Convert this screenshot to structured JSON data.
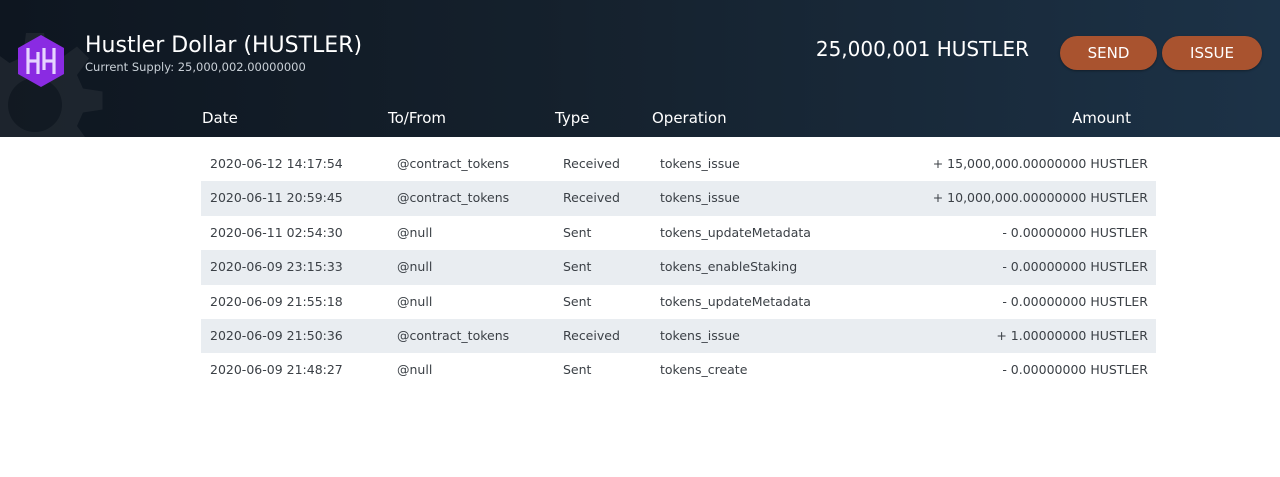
{
  "header": {
    "title": "Hustler Dollar (HUSTLER)",
    "supply": "Current Supply: 25,000,002.00000000",
    "balance": "25,000,001 HUSTLER",
    "send_label": "SEND",
    "issue_label": "ISSUE",
    "logo_icon": "hustler-logo-icon",
    "accent_color": "#a9532f",
    "logo_color": "#8a2be2"
  },
  "table": {
    "columns": [
      "Date",
      "To/From",
      "Type",
      "Operation",
      "Amount"
    ],
    "rows": [
      {
        "date": "2020-06-12 14:17:54",
        "to": "@contract_tokens",
        "type": "Received",
        "op": "tokens_issue",
        "amount": "+ 15,000,000.00000000 HUSTLER"
      },
      {
        "date": "2020-06-11 20:59:45",
        "to": "@contract_tokens",
        "type": "Received",
        "op": "tokens_issue",
        "amount": "+ 10,000,000.00000000 HUSTLER"
      },
      {
        "date": "2020-06-11 02:54:30",
        "to": "@null",
        "type": "Sent",
        "op": "tokens_updateMetadata",
        "amount": "- 0.00000000 HUSTLER"
      },
      {
        "date": "2020-06-09 23:15:33",
        "to": "@null",
        "type": "Sent",
        "op": "tokens_enableStaking",
        "amount": "- 0.00000000 HUSTLER"
      },
      {
        "date": "2020-06-09 21:55:18",
        "to": "@null",
        "type": "Sent",
        "op": "tokens_updateMetadata",
        "amount": "- 0.00000000 HUSTLER"
      },
      {
        "date": "2020-06-09 21:50:36",
        "to": "@contract_tokens",
        "type": "Received",
        "op": "tokens_issue",
        "amount": "+ 1.00000000 HUSTLER"
      },
      {
        "date": "2020-06-09 21:48:27",
        "to": "@null",
        "type": "Sent",
        "op": "tokens_create",
        "amount": "- 0.00000000 HUSTLER"
      }
    ]
  }
}
